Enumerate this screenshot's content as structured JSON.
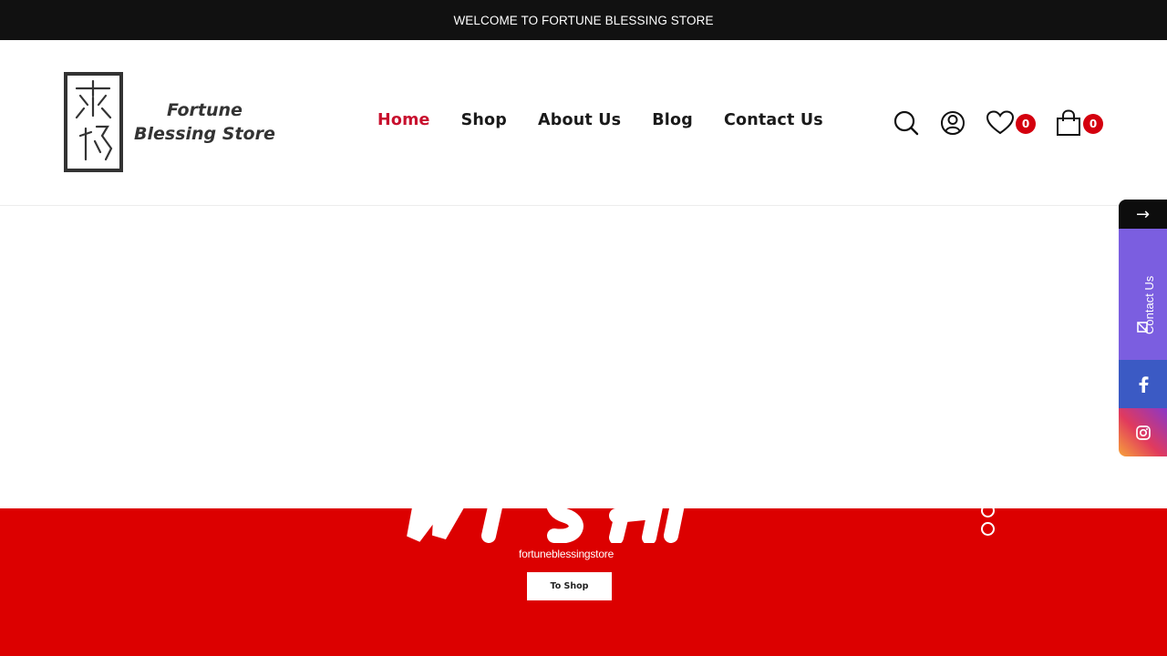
{
  "topbar": {
    "text": "WELCOME TO FORTUNE BLESSING STORE"
  },
  "logo": {
    "line1": "Fortune",
    "line2": "Blessing Store"
  },
  "nav": {
    "items": [
      {
        "label": "Home",
        "active": true
      },
      {
        "label": "Shop",
        "active": false
      },
      {
        "label": "About Us",
        "active": false
      },
      {
        "label": "Blog",
        "active": false
      },
      {
        "label": "Contact Us",
        "active": false
      }
    ]
  },
  "header_icons": {
    "search": "search-icon",
    "account": "user-icon",
    "wishlist": {
      "icon": "heart-icon",
      "count": "0"
    },
    "cart": {
      "icon": "shopping-bag-icon",
      "count": "0"
    }
  },
  "hero": {
    "subtitle": "fortuneblessingstore",
    "button_label": "To Shop",
    "background_color": "#dc0000"
  },
  "side_panel": {
    "arrow": "→",
    "contact_label": "Contact Us",
    "facebook": "facebook-icon",
    "instagram": "instagram-icon"
  },
  "colors": {
    "accent": "#c8102e",
    "badge": "#d4000e",
    "topbar": "#111111"
  }
}
